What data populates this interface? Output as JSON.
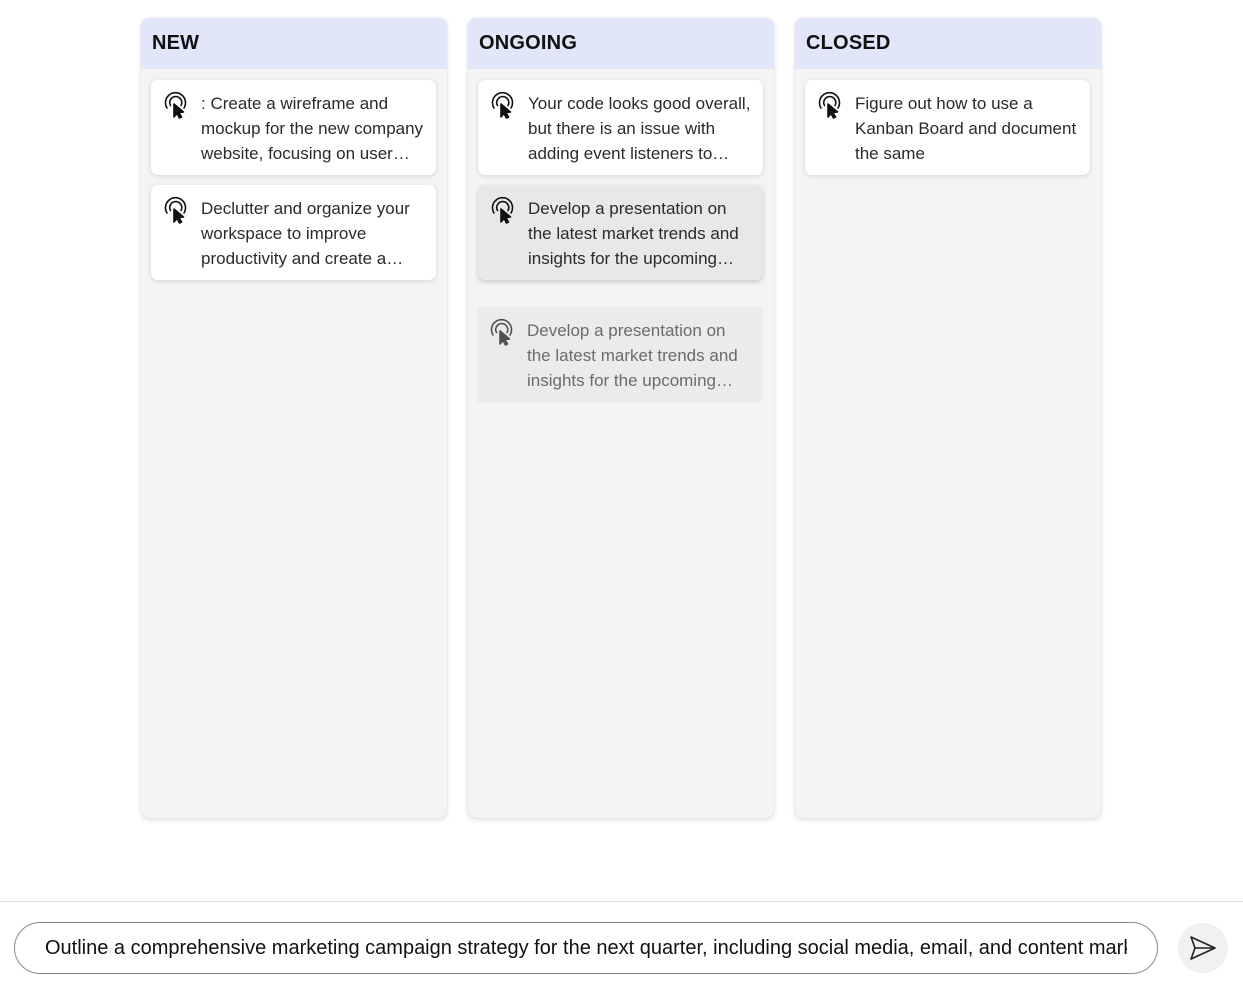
{
  "columns": [
    {
      "title": "NEW",
      "cards": [
        {
          "text": ": Create a wireframe and mockup for the new company website, focusing on user experience and modern design",
          "icon": "touch-pointer-icon"
        },
        {
          "text": "Declutter and organize your workspace to improve productivity and create a more efficient environment",
          "icon": "touch-pointer-icon"
        }
      ]
    },
    {
      "title": "ONGOING",
      "cards": [
        {
          "text": "Your code looks good overall, but there is an issue with adding event listeners to elements",
          "icon": "touch-pointer-icon"
        },
        {
          "text": "Develop a presentation on the latest market trends and insights for the upcoming meeting",
          "icon": "touch-pointer-icon",
          "state": "dragging"
        },
        {
          "text": "Develop a presentation on the latest market trends and insights for the upcoming meeting",
          "icon": "touch-pointer-icon",
          "state": "drop-placeholder"
        }
      ]
    },
    {
      "title": "CLOSED",
      "cards": [
        {
          "text": "Figure out how to use a Kanban Board and document the same",
          "icon": "touch-pointer-icon"
        }
      ]
    }
  ],
  "composer": {
    "value": "Outline a comprehensive marketing campaign strategy for the next quarter, including social media, email, and content marketing",
    "send_icon": "send-icon"
  },
  "colors": {
    "column_header_bg": "#e1e6fb",
    "column_bg": "#f4f4f4",
    "card_bg": "#ffffff"
  }
}
